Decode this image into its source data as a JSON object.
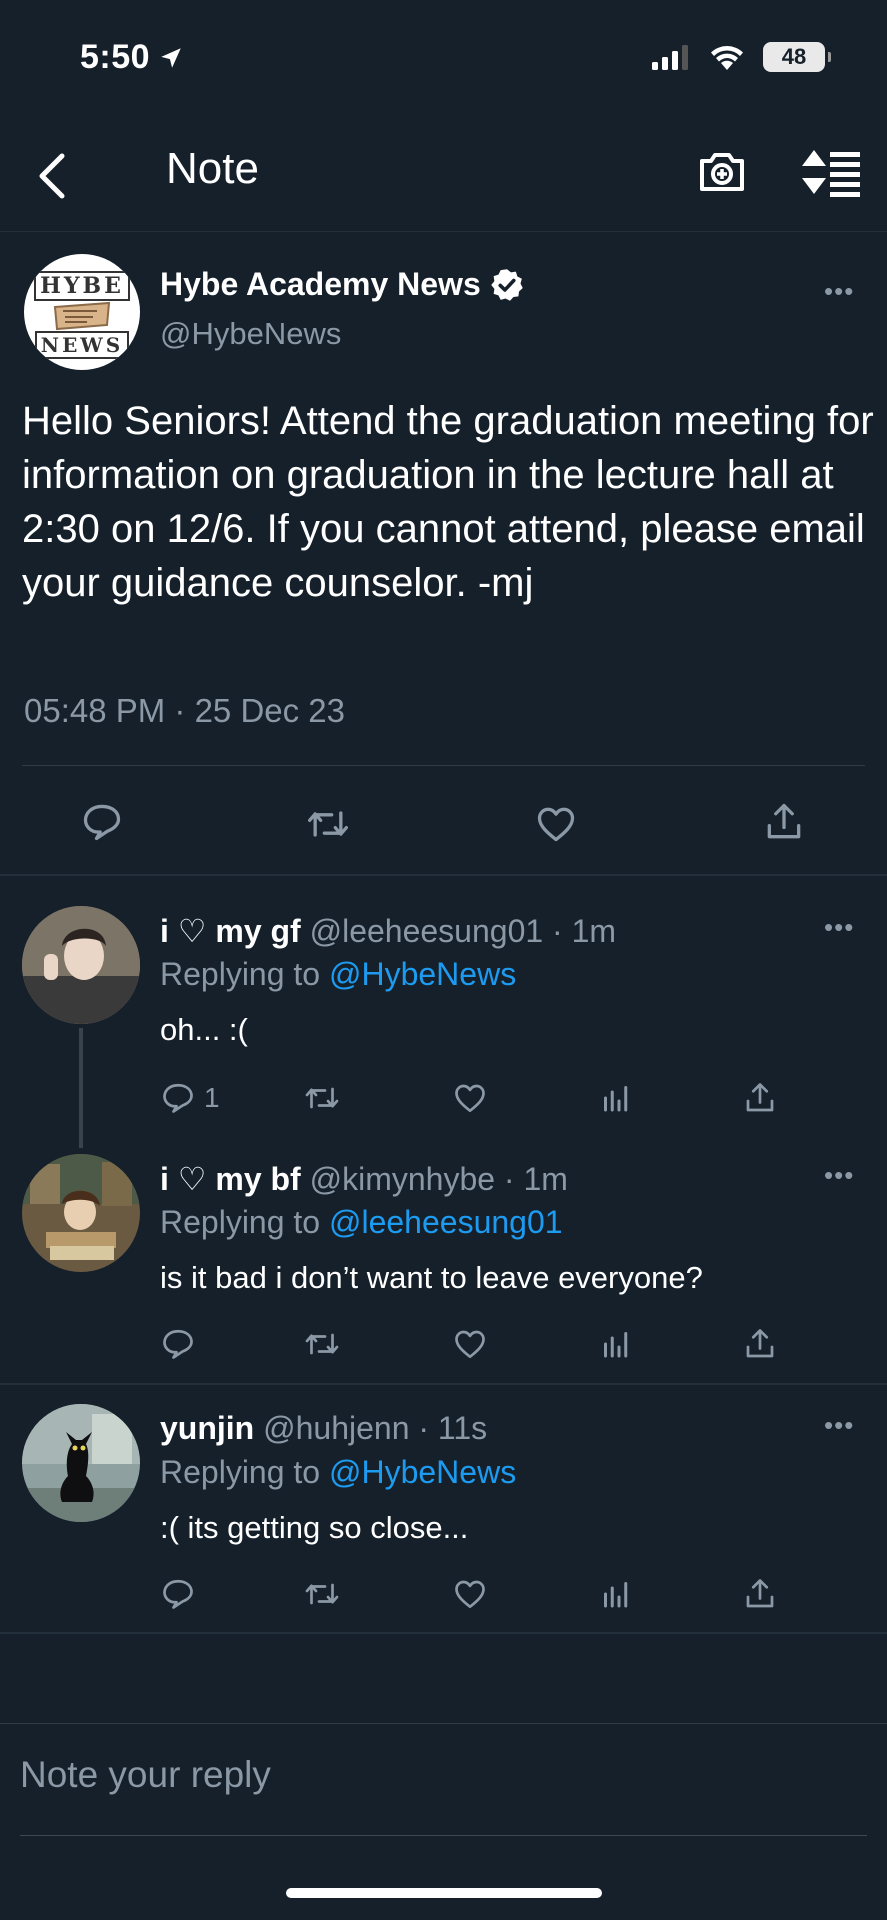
{
  "status_bar": {
    "time": "5:50",
    "battery": "48"
  },
  "nav": {
    "title": "Note"
  },
  "main_tweet": {
    "name": "Hybe Academy News",
    "handle": "@HybeNews",
    "logo_top": "HYBE",
    "logo_bottom": "NEWS",
    "text": "Hello Seniors! Attend the graduation meeting for information on graduation in the lecture hall at 2:30 on 12/6. If you cannot attend, please email your guidance counselor. -mj",
    "timestamp": "05:48 PM · 25 Dec 23"
  },
  "replies": [
    {
      "name": "i ♡ my gf",
      "handle": "@leeheesung01",
      "time": "· 1m",
      "replying_label": "Replying to",
      "replying_to": "@HybeNews",
      "text": "oh... :(",
      "reply_count": "1"
    },
    {
      "name": "i ♡ my bf",
      "handle": "@kimynhybe",
      "time": "· 1m",
      "replying_label": "Replying to",
      "replying_to": "@leeheesung01",
      "text": "is it bad i don’t want to leave everyone?",
      "reply_count": ""
    },
    {
      "name": "yunjin",
      "handle": "@huhjenn",
      "time": "· 11s",
      "replying_label": "Replying to",
      "replying_to": "@HybeNews",
      "text": ":( its getting so close...",
      "reply_count": ""
    }
  ],
  "reply_box": {
    "placeholder": "Note your reply"
  },
  "more_label": "•••",
  "colors": {
    "background": "#15202b",
    "link": "#1d9bf0",
    "muted": "#8b98a5",
    "text": "#ffffff"
  }
}
